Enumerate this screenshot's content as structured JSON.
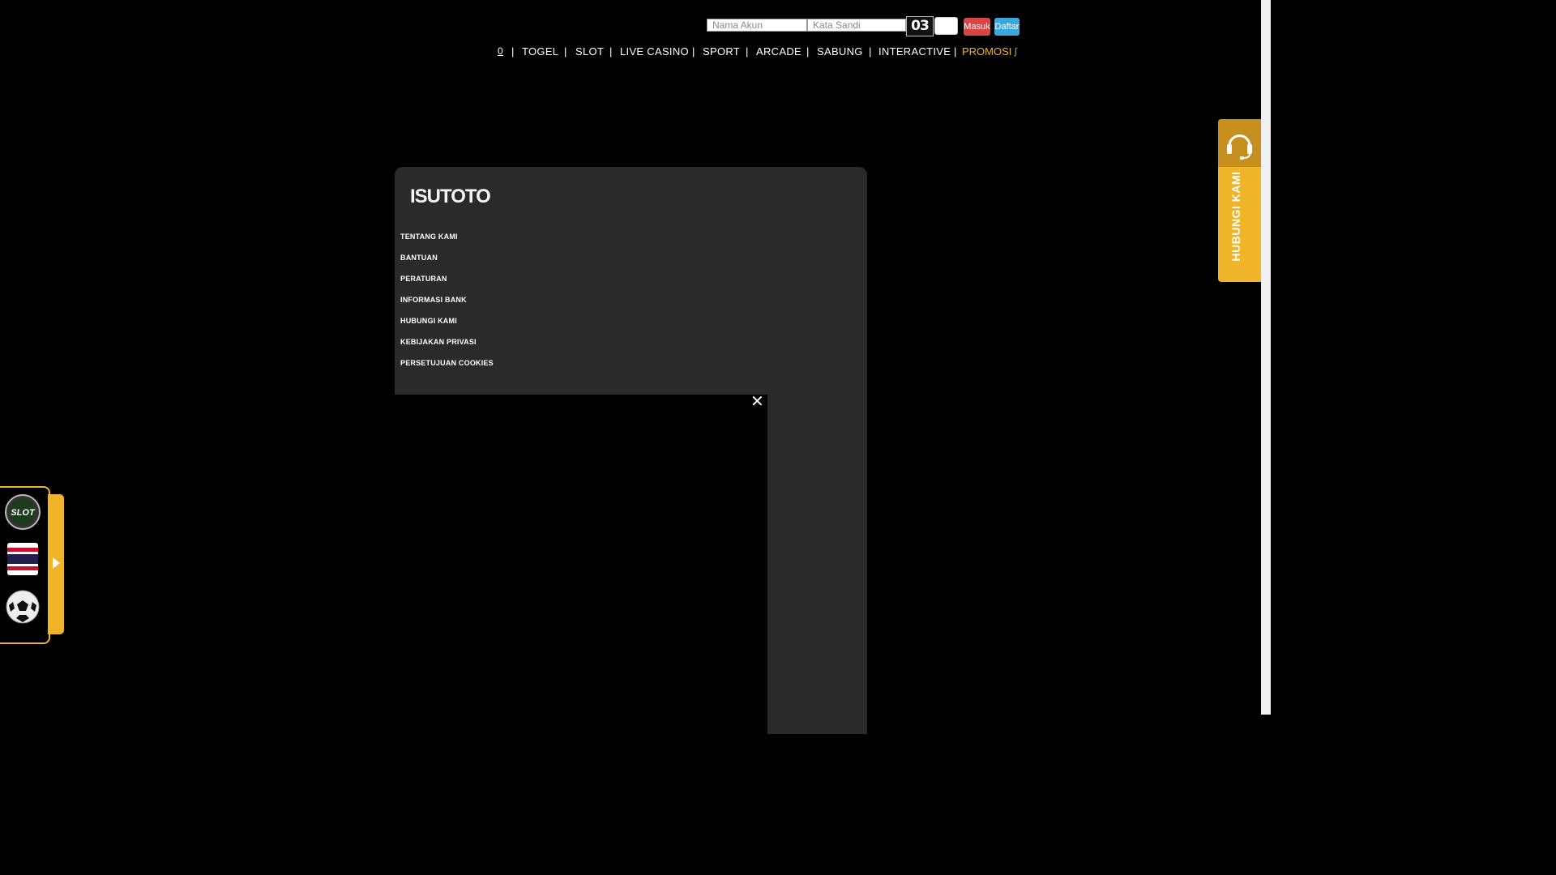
{
  "login": {
    "username_placeholder": "Nama Akun",
    "password_placeholder": "Kata Sandi",
    "captcha_code": "03",
    "login_label": "Masuk",
    "register_label": "Daftar"
  },
  "nav": {
    "home_icon": "home-icon",
    "separator": "|",
    "items": [
      "TOGEL",
      "SLOT",
      "LIVE CASINO",
      "SPORT",
      "ARCADE",
      "SABUNG",
      "INTERACTIVE"
    ],
    "promo_label": "PROMOSI",
    "home_glyph": "0",
    "promo_icon_glyph": "ʃ"
  },
  "panel": {
    "logo_text": "ISUTOTO",
    "menu": [
      "TENTANG KAMI",
      "BANTUAN",
      "PERATURAN",
      "INFORMASI BANK",
      "HUBUNGI KAMI",
      "KEBIJAKAN PRIVASI",
      "PERSETUJUAN COOKIES"
    ],
    "close_glyph": "✕"
  },
  "contact": {
    "label": "HUBUNGI KAMI",
    "icon": "headset-icon"
  },
  "dock": {
    "icons": [
      "vip-slot-icon",
      "thailand-flag-icon",
      "soccer-ball-icon"
    ],
    "toggle_icon": "arrow-right-icon"
  },
  "colors": {
    "accent": "#f0b429",
    "login_button": "#d94545",
    "register_button": "#3ba7e0",
    "panel_bg": "#2a2a2a"
  }
}
